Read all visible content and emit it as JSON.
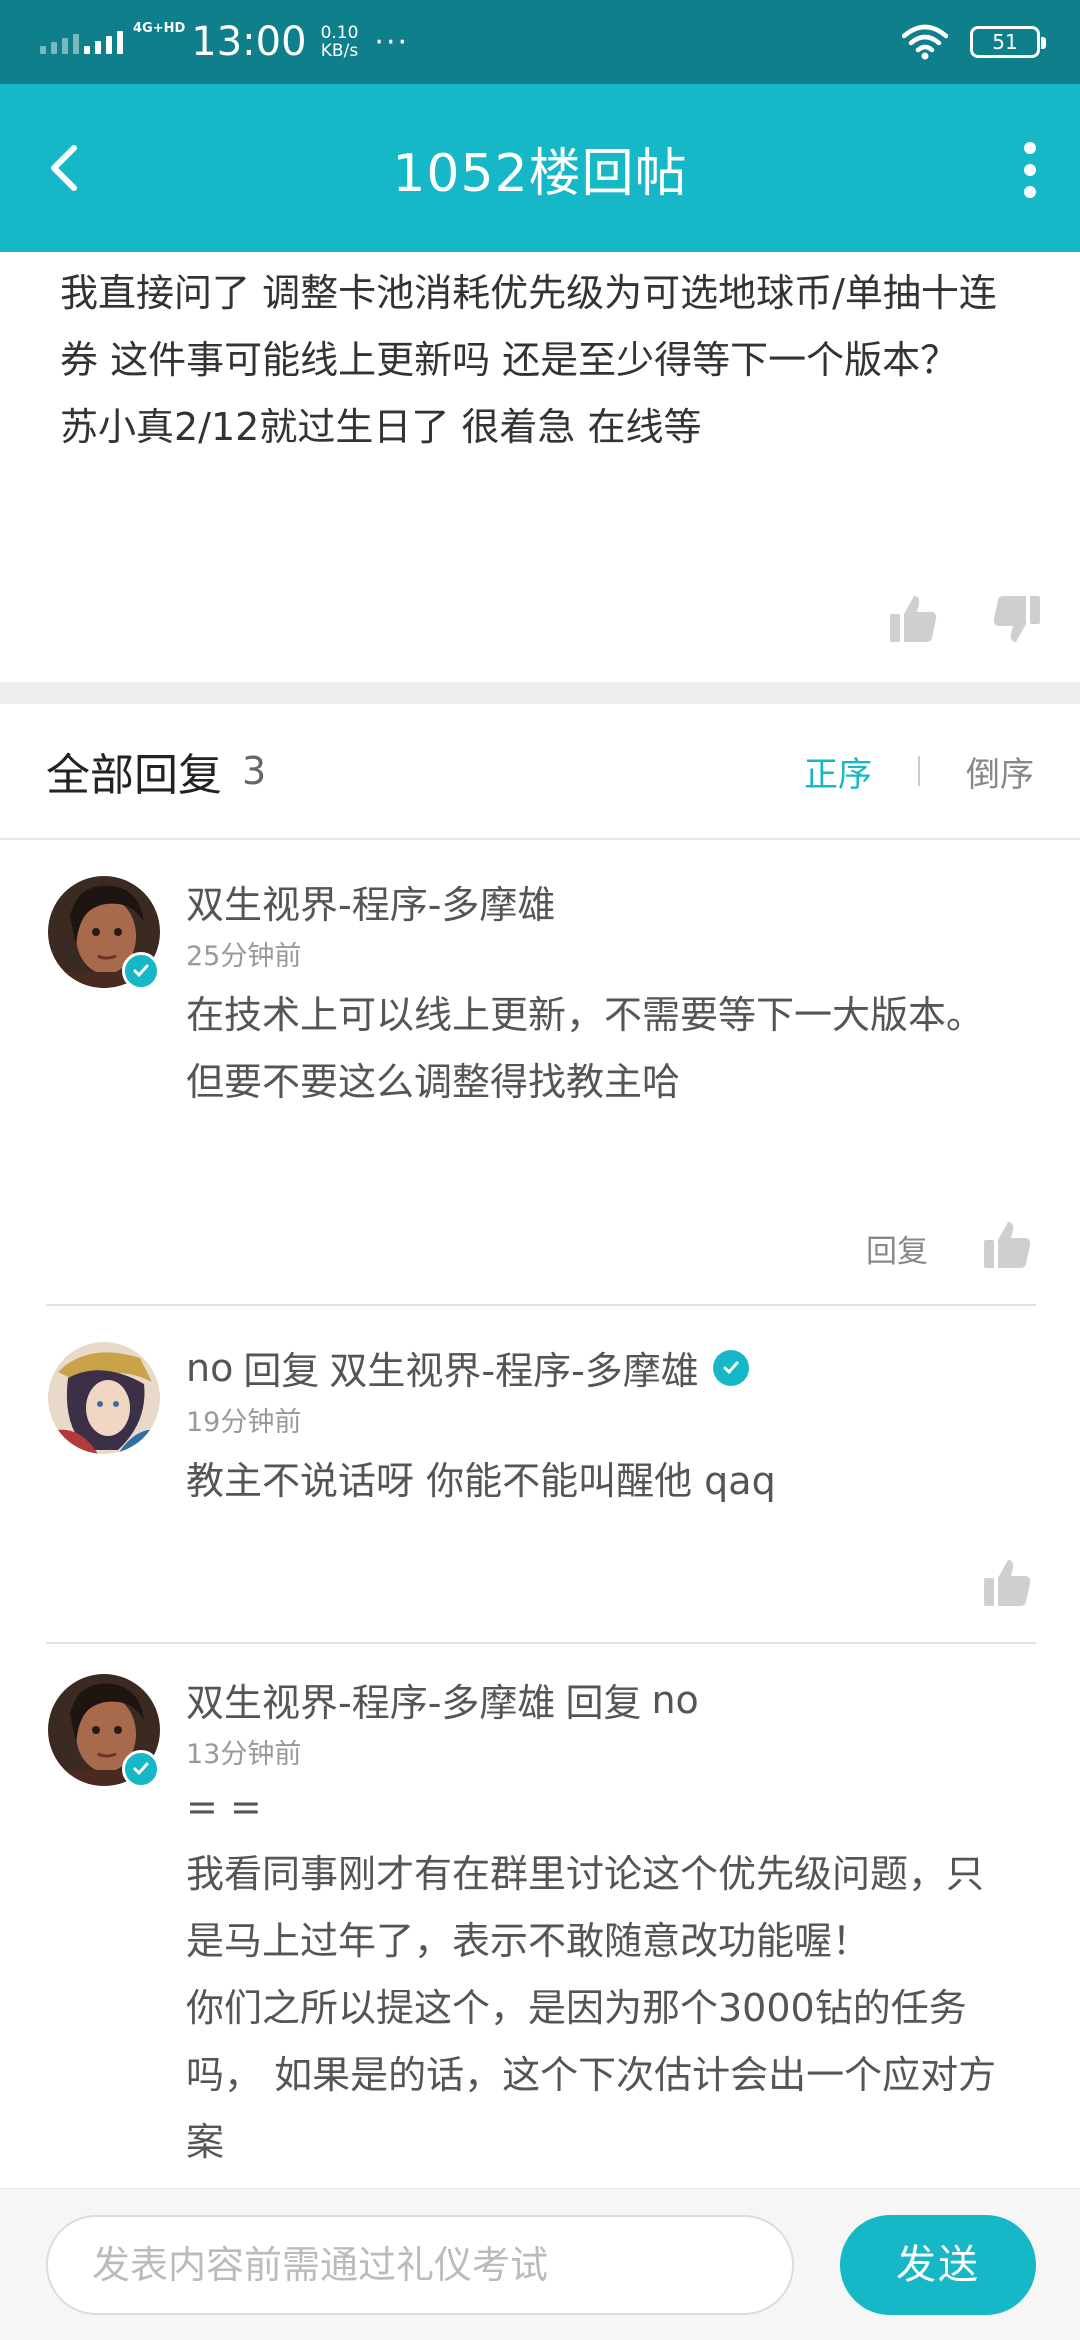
{
  "status_bar": {
    "network": "4G+HD",
    "time": "13:00",
    "speed_value": "0.10",
    "speed_unit": "KB/s",
    "more": "···",
    "battery": "51"
  },
  "nav": {
    "title": "1052楼回帖"
  },
  "post": {
    "lines": [
      "我直接问了 调整卡池消耗优先级为可选地球币/单抽十连券 这件事可能线上更新吗 还是至少得等下一个版本？",
      "苏小真2/12就过生日了 很着急 在线等"
    ]
  },
  "replies_header": {
    "title": "全部回复",
    "count": "3",
    "sort_asc": "正序",
    "sort_desc": "倒序"
  },
  "replies": [
    {
      "author": "双生视界-程序-多摩雄",
      "time": "25分钟前",
      "lines": [
        "在技术上可以线上更新，不需要等下一大版本。",
        "但要不要这么调整得找教主哈"
      ],
      "reply_label": "回复"
    },
    {
      "author": "no",
      "reply_word": "回复",
      "reply_to": "双生视界-程序-多摩雄",
      "time": "19分钟前",
      "lines": [
        "教主不说话呀 你能不能叫醒他 qaq"
      ]
    },
    {
      "author": "双生视界-程序-多摩雄",
      "reply_word": "回复",
      "reply_to": "no",
      "time": "13分钟前",
      "lines": [
        "= =",
        "我看同事刚才有在群里讨论这个优先级问题，只是马上过年了，表示不敢随意改功能喔！",
        "你们之所以提这个，是因为那个3000钻的任务吗， 如果是的话，这个下次估计会出一个应对方案"
      ]
    }
  ],
  "composer": {
    "placeholder": "发表内容前需通过礼仪考试",
    "send_label": "发送"
  },
  "colors": {
    "accent": "#16b7c6",
    "status_bar": "#0f7f8b"
  }
}
